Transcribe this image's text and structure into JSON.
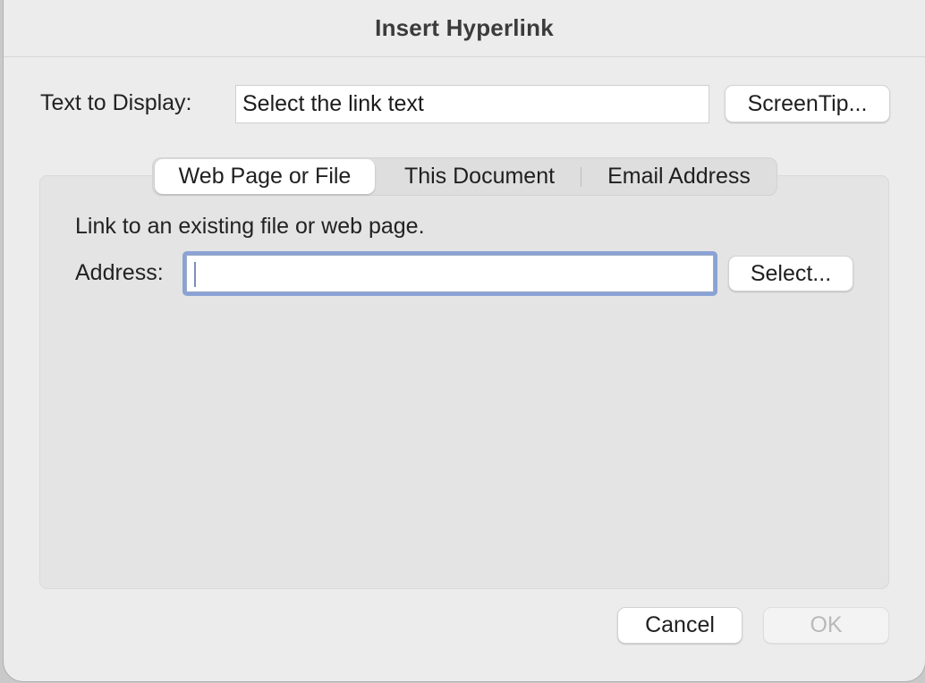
{
  "dialog": {
    "title": "Insert Hyperlink"
  },
  "display": {
    "label": "Text to Display:",
    "value": "Select the link text",
    "screentip_label": "ScreenTip..."
  },
  "tabs": [
    {
      "label": "Web Page or File",
      "selected": true
    },
    {
      "label": "This Document",
      "selected": false
    },
    {
      "label": "Email Address",
      "selected": false
    }
  ],
  "panel": {
    "description": "Link to an existing file or web page.",
    "address_label": "Address:",
    "address_value": "",
    "select_label": "Select..."
  },
  "footer": {
    "cancel_label": "Cancel",
    "ok_label": "OK",
    "ok_enabled": false
  },
  "colors": {
    "focus_ring": "#8aa2d4",
    "dialog_bg": "#ececec",
    "panel_bg": "#e4e4e4"
  }
}
